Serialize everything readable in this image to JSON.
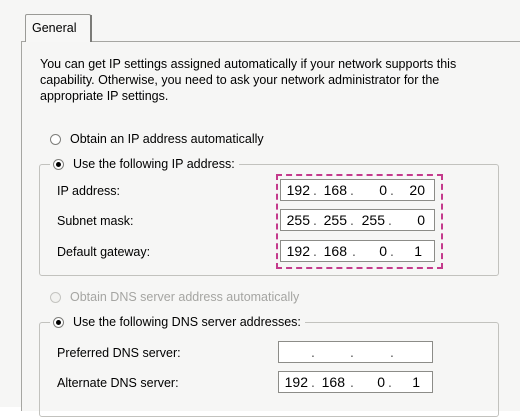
{
  "tab": {
    "label": "General"
  },
  "intro_text": "You can get IP settings assigned automatically if your network supports this capability. Otherwise, you need to ask your network administrator for the appropriate IP settings.",
  "ip_auto": {
    "label": "Obtain an IP address automatically",
    "selected": false
  },
  "ip_manual": {
    "label": "Use the following IP address:",
    "selected": true
  },
  "ip_fields": {
    "ip_address": {
      "label": "IP address:",
      "octets": [
        "192",
        "168",
        "0",
        "20"
      ]
    },
    "subnet_mask": {
      "label": "Subnet mask:",
      "octets": [
        "255",
        "255",
        "255",
        "0"
      ]
    },
    "default_gateway": {
      "label": "Default gateway:",
      "octets": [
        "192",
        "168",
        "0",
        "1"
      ]
    }
  },
  "dns_auto": {
    "label": "Obtain DNS server address automatically",
    "selected": false,
    "disabled": true
  },
  "dns_manual": {
    "label": "Use the following DNS server addresses:",
    "selected": true
  },
  "dns_fields": {
    "preferred": {
      "label": "Preferred DNS server:",
      "octets": [
        "",
        "",
        "",
        ""
      ]
    },
    "alternate": {
      "label": "Alternate DNS server:",
      "octets": [
        "192",
        "168",
        "0",
        "1"
      ]
    }
  },
  "colors": {
    "highlight_dash": "#c43a8c"
  }
}
